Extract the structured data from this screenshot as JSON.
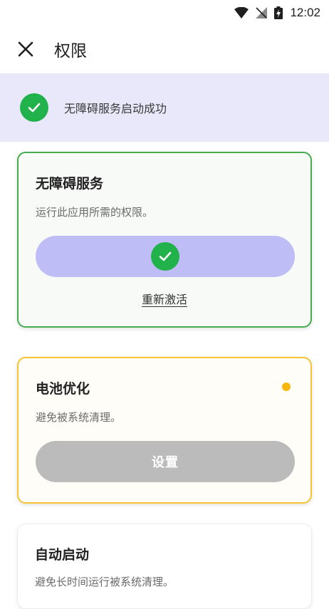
{
  "status_bar": {
    "time": "12:02",
    "icons": [
      "wifi-icon",
      "no-sim-icon",
      "battery-charging-icon"
    ]
  },
  "app_bar": {
    "close_icon": "close-icon",
    "title": "权限"
  },
  "banner": {
    "icon": "check-circle-icon",
    "text": "无障碍服务启动成功",
    "background": "#e9e8fb",
    "icon_color": "#22b24c"
  },
  "cards": {
    "accessibility": {
      "title": "无障碍服务",
      "description": "运行此应用所需的权限。",
      "button_icon": "check-circle-icon",
      "link": "重新激活",
      "border_color": "#43ad4f",
      "button_color": "#bebdf5"
    },
    "battery": {
      "title": "电池优化",
      "description": "避免被系统清理。",
      "button_label": "设置",
      "status_dot_color": "#f6b70f",
      "border_color": "#f6c331",
      "button_color": "#bbbbbb"
    },
    "autostart": {
      "title": "自动启动",
      "description": "避免长时间运行被系统清理。"
    }
  }
}
